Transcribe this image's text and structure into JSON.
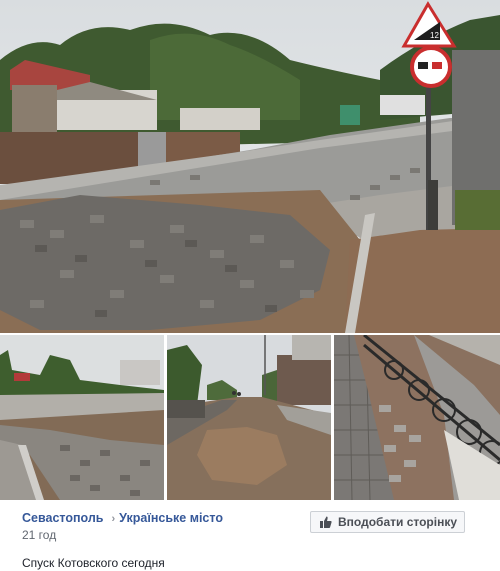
{
  "post": {
    "page_name": "Севастополь",
    "separator": "›",
    "section_name": "Українське місто",
    "time": "21 год",
    "caption": "Спуск Котовского сегодня",
    "like_button_label": "Вподобати сторінку"
  },
  "photos": [
    {
      "id": "main",
      "description_icon": "street-photo"
    },
    {
      "id": "a",
      "description_icon": "street-photo"
    },
    {
      "id": "b",
      "description_icon": "street-photo"
    },
    {
      "id": "c",
      "description_icon": "street-photo"
    }
  ],
  "colors": {
    "link": "#365899",
    "muted": "#616770",
    "text": "#1d2129",
    "button_bg": "#f6f7f9",
    "button_border": "#ccd0d5"
  }
}
